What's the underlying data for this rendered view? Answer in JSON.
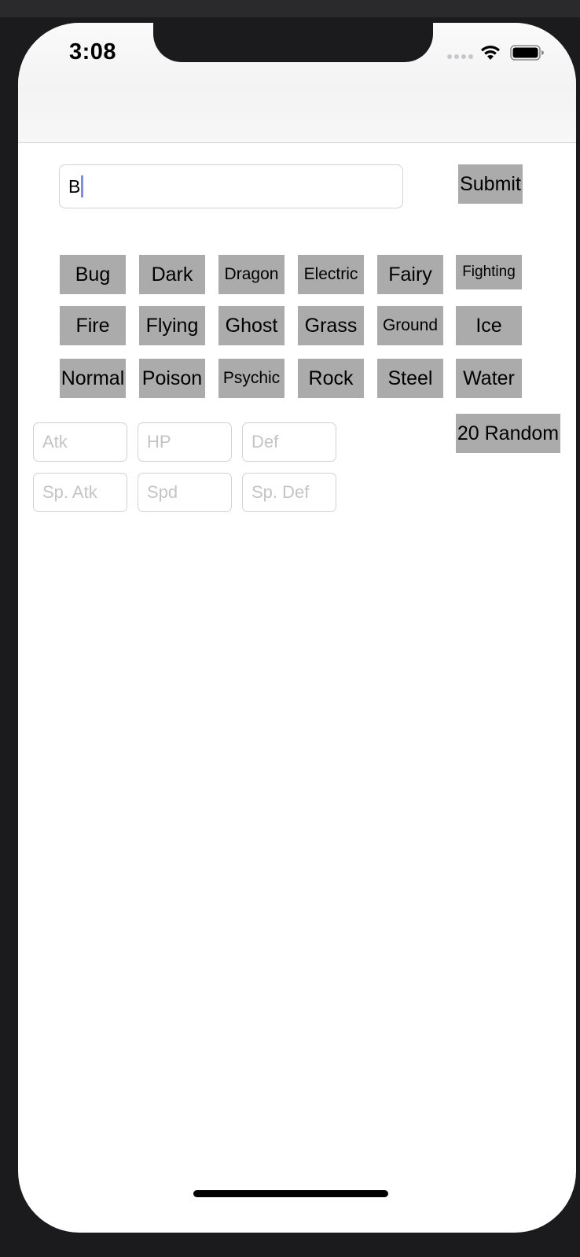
{
  "status_bar": {
    "time": "3:08"
  },
  "search": {
    "value": "B"
  },
  "submit_label": "Submit",
  "types": [
    "Bug",
    "Dark",
    "Dragon",
    "Electric",
    "Fairy",
    "Fighting",
    "Fire",
    "Flying",
    "Ghost",
    "Grass",
    "Ground",
    "Ice",
    "Normal",
    "Poison",
    "Psychic",
    "Rock",
    "Steel",
    "Water"
  ],
  "random_label": "20 Random",
  "stats": {
    "atk": "Atk",
    "hp": "HP",
    "def": "Def",
    "sp_atk": "Sp. Atk",
    "spd": "Spd",
    "sp_def": "Sp. Def"
  },
  "colors": {
    "button_gray": "#ababab",
    "cursor": "#7d8df2"
  },
  "icons": [
    "cellular-signal-icon",
    "wifi-icon",
    "battery-icon"
  ]
}
